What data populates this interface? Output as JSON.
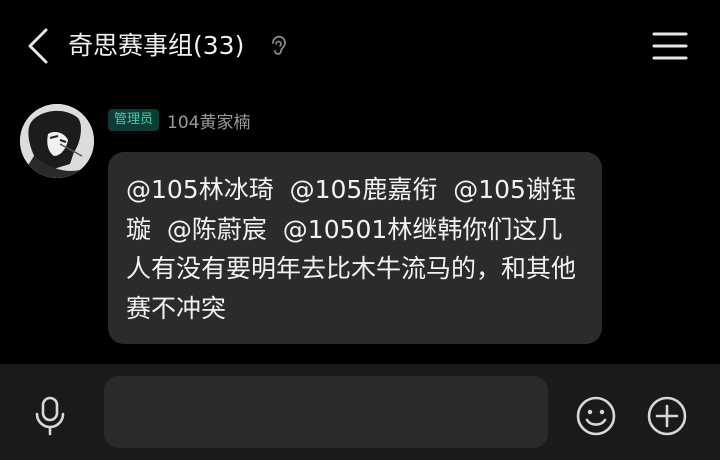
{
  "header": {
    "title": "奇思赛事组(33)",
    "back_icon": "chevron-left-icon",
    "status_icon": "ear-icon",
    "menu_icon": "hamburger-menu-icon"
  },
  "message": {
    "avatar_icon": "avatar-image",
    "role_badge": "管理员",
    "sender": "104黄家楠",
    "text": "@105林冰琦  @105鹿嘉衔  @105谢钰璇  @陈蔚宸  @10501林继韩你们这几人有没有要明年去比木牛流马的，和其他赛不冲突"
  },
  "input_bar": {
    "mic_icon": "microphone-icon",
    "input_value": "",
    "emoji_icon": "smiley-icon",
    "plus_icon": "plus-circle-icon"
  },
  "colors": {
    "background": "#000000",
    "bubble": "#2b2b2b",
    "badge_bg": "#0d3b35",
    "badge_text": "#3ad0b0",
    "input_bar": "#1a1a1a"
  }
}
